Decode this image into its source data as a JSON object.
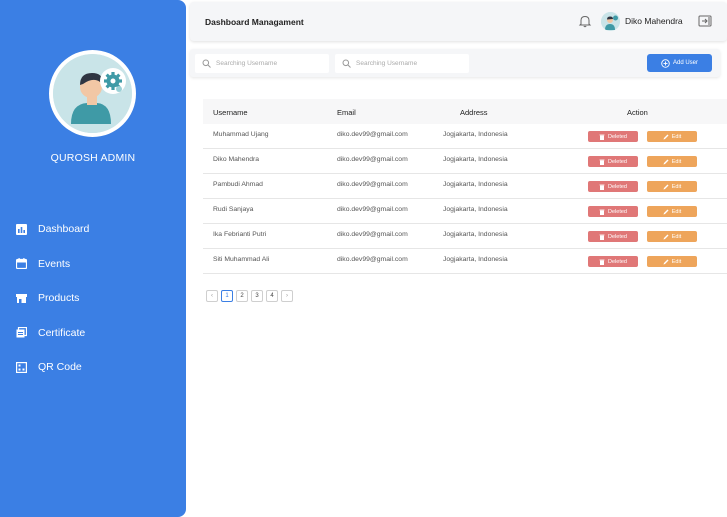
{
  "sidebar": {
    "admin_name": "QUROSH ADMIN",
    "items": [
      {
        "label": "Dashboard",
        "icon": "bar-chart-icon"
      },
      {
        "label": "Events",
        "icon": "calendar-icon"
      },
      {
        "label": "Products",
        "icon": "store-icon"
      },
      {
        "label": "Certificate",
        "icon": "certificate-icon"
      },
      {
        "label": "QR Code",
        "icon": "qr-code-icon"
      }
    ]
  },
  "header": {
    "title": "Dashboard Managament",
    "user_name": "Diko Mahendra"
  },
  "search": {
    "placeholder_1": "Searching Username",
    "placeholder_2": "Searching Username",
    "add_user_label": "Add User"
  },
  "table": {
    "headers": [
      "Username",
      "Email",
      "Address",
      "Action"
    ],
    "rows": [
      {
        "username": "Muhammad Ujang",
        "email": "diko.dev99@gmail.com",
        "address": "Jogjakarta, Indonesia"
      },
      {
        "username": "Diko Mahendra",
        "email": "diko.dev99@gmail.com",
        "address": "Jogjakarta, Indonesia"
      },
      {
        "username": "Pambudi Ahmad",
        "email": "diko.dev99@gmail.com",
        "address": "Jogjakarta, Indonesia"
      },
      {
        "username": "Rudi Sanjaya",
        "email": "diko.dev99@gmail.com",
        "address": "Jogjakarta, Indonesia"
      },
      {
        "username": "Ika Febrianti Putri",
        "email": "diko.dev99@gmail.com",
        "address": "Jogjakarta, Indonesia"
      },
      {
        "username": "Siti Muhammad Ali",
        "email": "diko.dev99@gmail.com",
        "address": "Jogjakarta, Indonesia"
      }
    ],
    "delete_label": "Deleted",
    "edit_label": "Edit"
  },
  "pagination": {
    "prev": "‹",
    "pages": [
      "1",
      "2",
      "3",
      "4"
    ],
    "next": "›",
    "current": "1"
  },
  "colors": {
    "accent": "#3b7fe4",
    "delete": "#e07777",
    "edit": "#eea55b"
  }
}
